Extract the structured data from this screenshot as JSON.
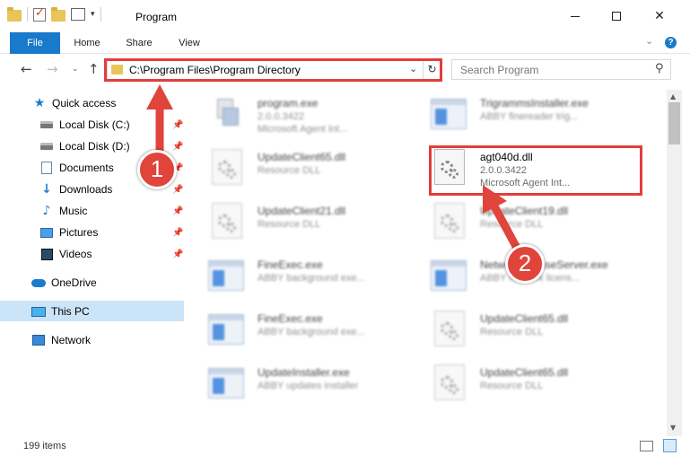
{
  "window": {
    "title": "Program",
    "minimize_glyph": "—",
    "maximize_glyph": "☐",
    "close_glyph": "✕"
  },
  "quick_access_toolbar": {
    "icons": [
      "folder-icon",
      "properties-check-icon",
      "new-folder-icon",
      "properties-icon"
    ],
    "dropdown_glyph": "▾"
  },
  "ribbon": {
    "tabs": [
      "File",
      "Home",
      "Share",
      "View"
    ],
    "expand_glyph": "⌄",
    "help_glyph": "?",
    "accent_color": "#1979ca"
  },
  "navigation": {
    "back_glyph": "←",
    "forward_glyph": "→",
    "recent_glyph": "⌄",
    "up_glyph": "↑",
    "address": "C:\\Program Files\\Program Directory",
    "address_dropdown_glyph": "⌄",
    "refresh_glyph": "↻",
    "search_placeholder": "Search Program",
    "search_glyph": "⚲"
  },
  "sidebar": {
    "items": [
      {
        "label": "Quick access",
        "icon": "star-icon",
        "pinned": false
      },
      {
        "label": "Local Disk (C:)",
        "icon": "disk-icon",
        "pinned": true
      },
      {
        "label": "Local Disk (D:)",
        "icon": "disk-icon",
        "pinned": true
      },
      {
        "label": "Documents",
        "icon": "documents-icon",
        "pinned": true
      },
      {
        "label": "Downloads",
        "icon": "downloads-icon",
        "pinned": true
      },
      {
        "label": "Music",
        "icon": "music-icon",
        "pinned": true
      },
      {
        "label": "Pictures",
        "icon": "pictures-icon",
        "pinned": true
      },
      {
        "label": "Videos",
        "icon": "videos-icon",
        "pinned": true
      },
      {
        "label": "OneDrive",
        "icon": "onedrive-icon",
        "pinned": false
      },
      {
        "label": "This PC",
        "icon": "this-pc-icon",
        "pinned": false,
        "selected": true
      },
      {
        "label": "Network",
        "icon": "network-icon",
        "pinned": false
      }
    ],
    "pin_glyph": "📌",
    "star_glyph": "★",
    "download_glyph": "↓",
    "music_glyph": "♪"
  },
  "files": [
    {
      "name": "program.exe",
      "line1": "2.0.0.3422",
      "line2": "Microsoft Agent Int...",
      "icon": "exe-icon",
      "blurred": true
    },
    {
      "name": "TrigrammsInstaller.exe",
      "line1": "ABBY finereader trig...",
      "line2": "",
      "icon": "app-window-icon",
      "blurred": true
    },
    {
      "name": "UpdateClient65.dll",
      "line1": "Resource DLL",
      "line2": "",
      "icon": "dll-gear-icon",
      "blurred": true
    },
    {
      "name": "agt040d.dll",
      "line1": "2.0.0.3422",
      "line2": "Microsoft Agent Int...",
      "icon": "dll-gear-icon",
      "blurred": false,
      "highlighted": true
    },
    {
      "name": "UpdateClient21.dll",
      "line1": "Resource DLL",
      "line2": "",
      "icon": "dll-gear-icon",
      "blurred": true
    },
    {
      "name": "UpdateClient19.dll",
      "line1": "Resource DLL",
      "line2": "",
      "icon": "dll-gear-icon",
      "blurred": true
    },
    {
      "name": "FineExec.exe",
      "line1": "ABBY background exe...",
      "line2": "",
      "icon": "app-window-icon",
      "blurred": true
    },
    {
      "name": "NetworkLicenseServer.exe",
      "line1": "ABBY network licens...",
      "line2": "",
      "icon": "app-window-icon",
      "blurred": true
    },
    {
      "name": "FineExec.exe",
      "line1": "ABBY background exe...",
      "line2": "",
      "icon": "app-window-icon",
      "blurred": true
    },
    {
      "name": "UpdateClient65.dll",
      "line1": "Resource DLL",
      "line2": "",
      "icon": "dll-gear-icon",
      "blurred": true
    },
    {
      "name": "UpdateInstaller.exe",
      "line1": "ABBY updates installer",
      "line2": "",
      "icon": "app-window-icon",
      "blurred": true
    },
    {
      "name": "UpdateClient65.dll",
      "line1": "Resource DLL",
      "line2": "",
      "icon": "dll-gear-icon",
      "blurred": true
    }
  ],
  "scrollbar": {
    "up_glyph": "▲",
    "down_glyph": "▼"
  },
  "status_bar": {
    "item_count": "199 items"
  },
  "annotations": {
    "step1_label": "1",
    "step2_label": "2",
    "highlight_color": "#e23d3d"
  }
}
